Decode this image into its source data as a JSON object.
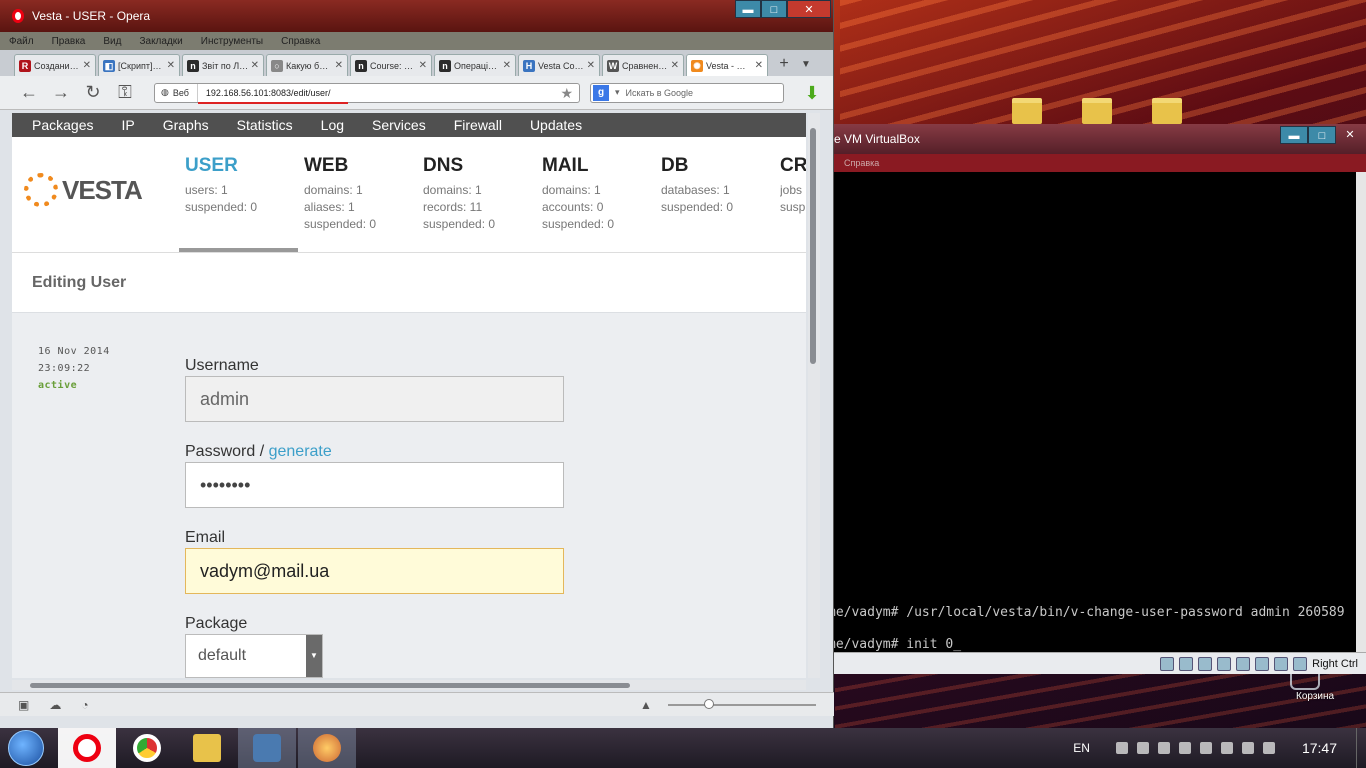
{
  "window": {
    "title": "Vesta - USER - Opera"
  },
  "menu": [
    "Файл",
    "Правка",
    "Вид",
    "Закладки",
    "Инструменты",
    "Справка"
  ],
  "tabs": [
    {
      "label": "Создани…",
      "icon": "R",
      "color": "#b0141b"
    },
    {
      "label": "[Скрипт]…",
      "icon": "◧",
      "color": "#3a74c0"
    },
    {
      "label": "Звіт по Л…",
      "icon": "n",
      "color": "#2b2b2b"
    },
    {
      "label": "Какую б…",
      "icon": "○",
      "color": "#888888"
    },
    {
      "label": "Course: …",
      "icon": "n",
      "color": "#2b2b2b"
    },
    {
      "label": "Операці…",
      "icon": "n",
      "color": "#2b2b2b"
    },
    {
      "label": "Vesta Co…",
      "icon": "H",
      "color": "#3a74c0"
    },
    {
      "label": "Сравнен…",
      "icon": "W",
      "color": "#555555"
    },
    {
      "label": "Vesta - …",
      "icon": "✺",
      "color": "#f08a1e"
    }
  ],
  "addressbar": {
    "badge": "Веб",
    "url": "192.168.56.101:8083/edit/user/",
    "search_placeholder": "Искать в Google"
  },
  "vesta": {
    "nav": [
      "Packages",
      "IP",
      "Graphs",
      "Statistics",
      "Log",
      "Services",
      "Firewall",
      "Updates"
    ],
    "logo": "VESTA",
    "stats": [
      {
        "title": "USER",
        "lines": [
          "users: 1",
          "suspended: 0"
        ]
      },
      {
        "title": "WEB",
        "lines": [
          "domains: 1",
          "aliases: 1",
          "suspended: 0"
        ]
      },
      {
        "title": "DNS",
        "lines": [
          "domains: 1",
          "records: 11",
          "suspended: 0"
        ]
      },
      {
        "title": "MAIL",
        "lines": [
          "domains: 1",
          "accounts: 0",
          "suspended: 0"
        ]
      },
      {
        "title": "DB",
        "lines": [
          "databases: 1",
          "suspended: 0"
        ]
      },
      {
        "title": "CR",
        "lines": [
          "jobs",
          "susp"
        ]
      }
    ],
    "heading": "Editing User",
    "meta": {
      "date": "16 Nov 2014",
      "time": "23:09:22",
      "status": "active"
    },
    "form": {
      "username_label": "Username",
      "username_value": "admin",
      "password_label": "Password /",
      "password_generate": "generate",
      "password_value": "••••••••",
      "email_label": "Email",
      "email_value": "vadym@mail.ua",
      "package_label": "Package",
      "package_value": "default"
    }
  },
  "virtualbox": {
    "title": "e VM VirtualBox",
    "menu": "Справка",
    "lines": [
      "me/vadym# /usr/local/vesta/bin/v-change-user-password admin 260589",
      "me/vadym# init 0_"
    ],
    "hostkey": "Right Ctrl"
  },
  "desktop": {
    "recycle_label": "Корзина"
  },
  "taskbar": {
    "lang": "EN",
    "time": "17:47"
  }
}
